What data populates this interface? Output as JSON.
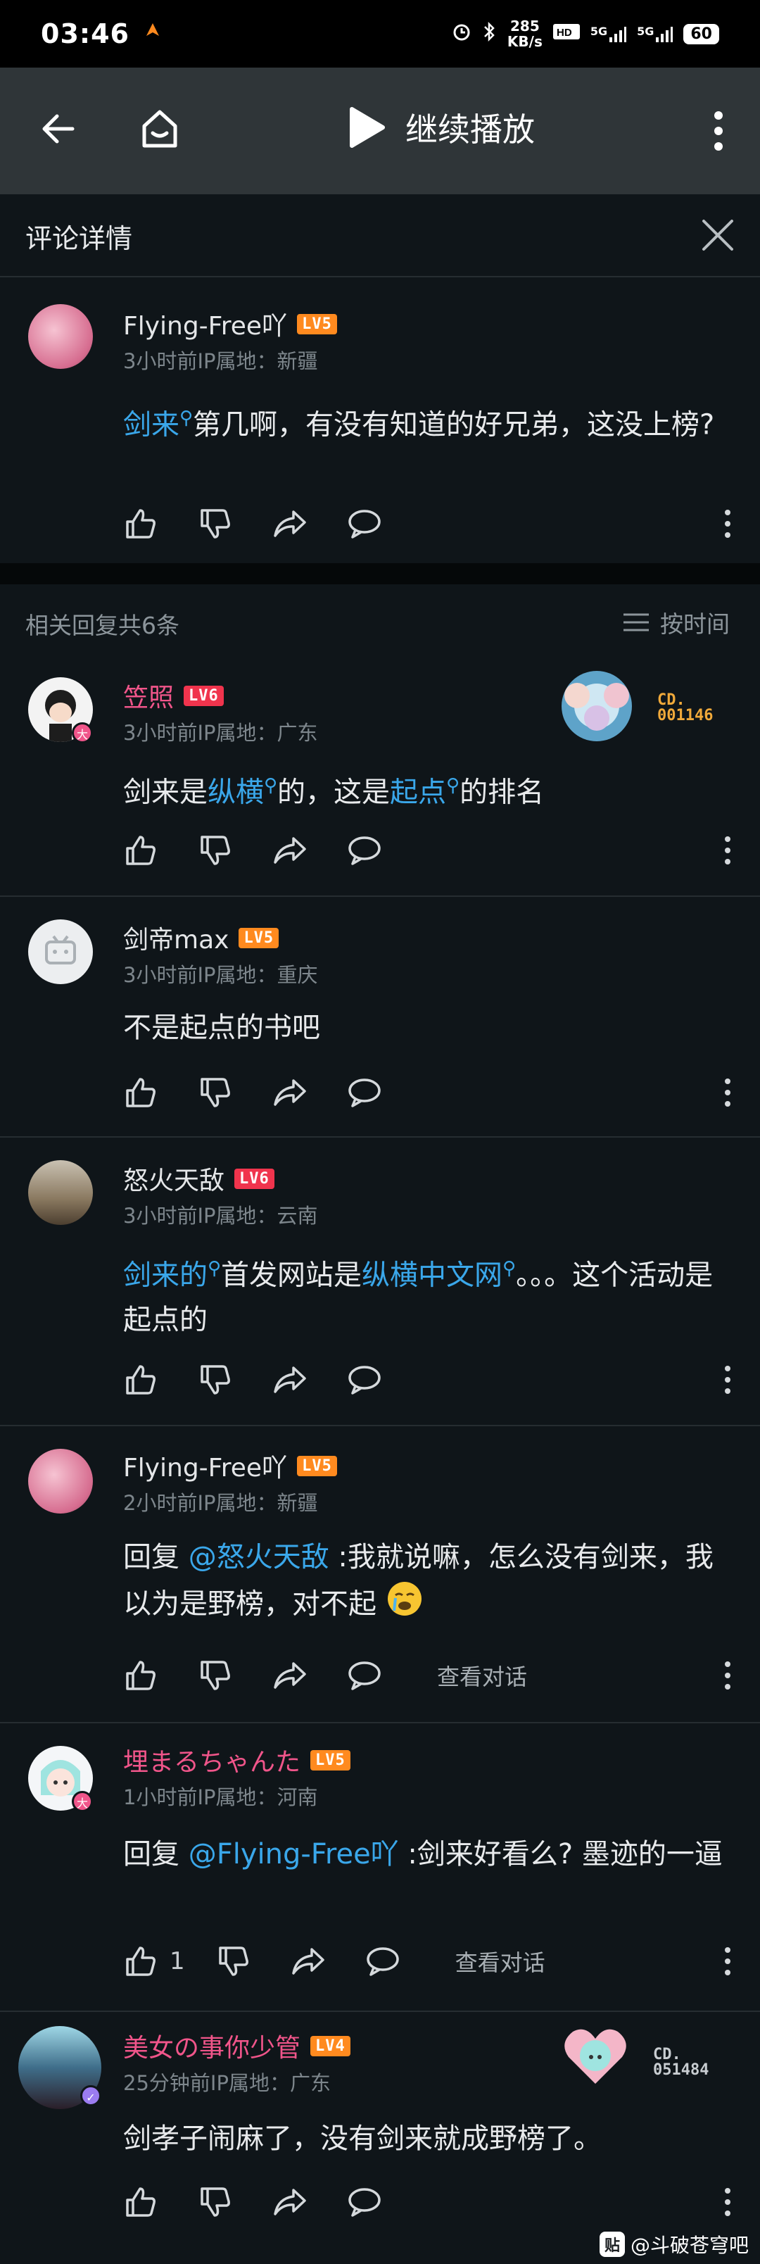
{
  "status_bar": {
    "time": "03:46",
    "speed_value": "285",
    "speed_unit": "KB/s",
    "net1": "5G",
    "net2": "5G",
    "battery": "60"
  },
  "nav": {
    "title": "继续播放"
  },
  "sheet": {
    "title": "评论详情"
  },
  "root_comment": {
    "username": "Flying-Free吖",
    "level": "LV5",
    "meta": "3小时前IP属地：新疆",
    "text_link": "剑来",
    "text_rest": "第几啊，有没有知道的好兄弟，这没上榜?"
  },
  "replies_header": {
    "count_label": "相关回复共6条",
    "sort_label": "按时间"
  },
  "replies": [
    {
      "username": "笠照",
      "level": "LV6",
      "meta": "3小时前IP属地：广东",
      "seg1": "剑来是",
      "link1": "纵横",
      "seg2": "的，这是",
      "link2": "起点",
      "seg3": "的排名",
      "fan_code": "CD.",
      "fan_number": "001146"
    },
    {
      "username": "剑帝max",
      "level": "LV5",
      "meta": "3小时前IP属地：重庆",
      "text": "不是起点的书吧"
    },
    {
      "username": "怒火天敌",
      "level": "LV6",
      "meta": "3小时前IP属地：云南",
      "link1": "剑来的",
      "seg1": "首发网站是",
      "link2": "纵横中文网",
      "seg2": "。。。这个活动是起点的"
    },
    {
      "username": "Flying-Free吖",
      "level": "LV5",
      "meta": "2小时前IP属地：新疆",
      "prefix": "回复 ",
      "mention": "@怒火天敌",
      "text": " :我就说嘛，怎么没有剑来，我以为是野榜，对不起",
      "view_conversation": "查看对话"
    },
    {
      "username": "埋まるちゃんた",
      "level": "LV5",
      "meta": "1小时前IP属地：河南",
      "prefix": "回复 ",
      "mention": "@Flying-Free吖",
      "text": " :剑来好看么? 墨迹的一逼",
      "like_count": "1",
      "view_conversation": "查看对话"
    },
    {
      "username": "美女の事你少管",
      "level": "LV4",
      "meta": "25分钟前IP属地：广东",
      "text": "剑孝子闹麻了，没有剑来就成野榜了。",
      "fan_code": "CD.",
      "fan_number": "051484"
    }
  ],
  "watermark": {
    "text": "@斗破苍穹吧"
  },
  "colors": {
    "accent_link": "#3aa7ea",
    "vip_name": "#f0558a",
    "level_badge": "#ff8a1f"
  }
}
